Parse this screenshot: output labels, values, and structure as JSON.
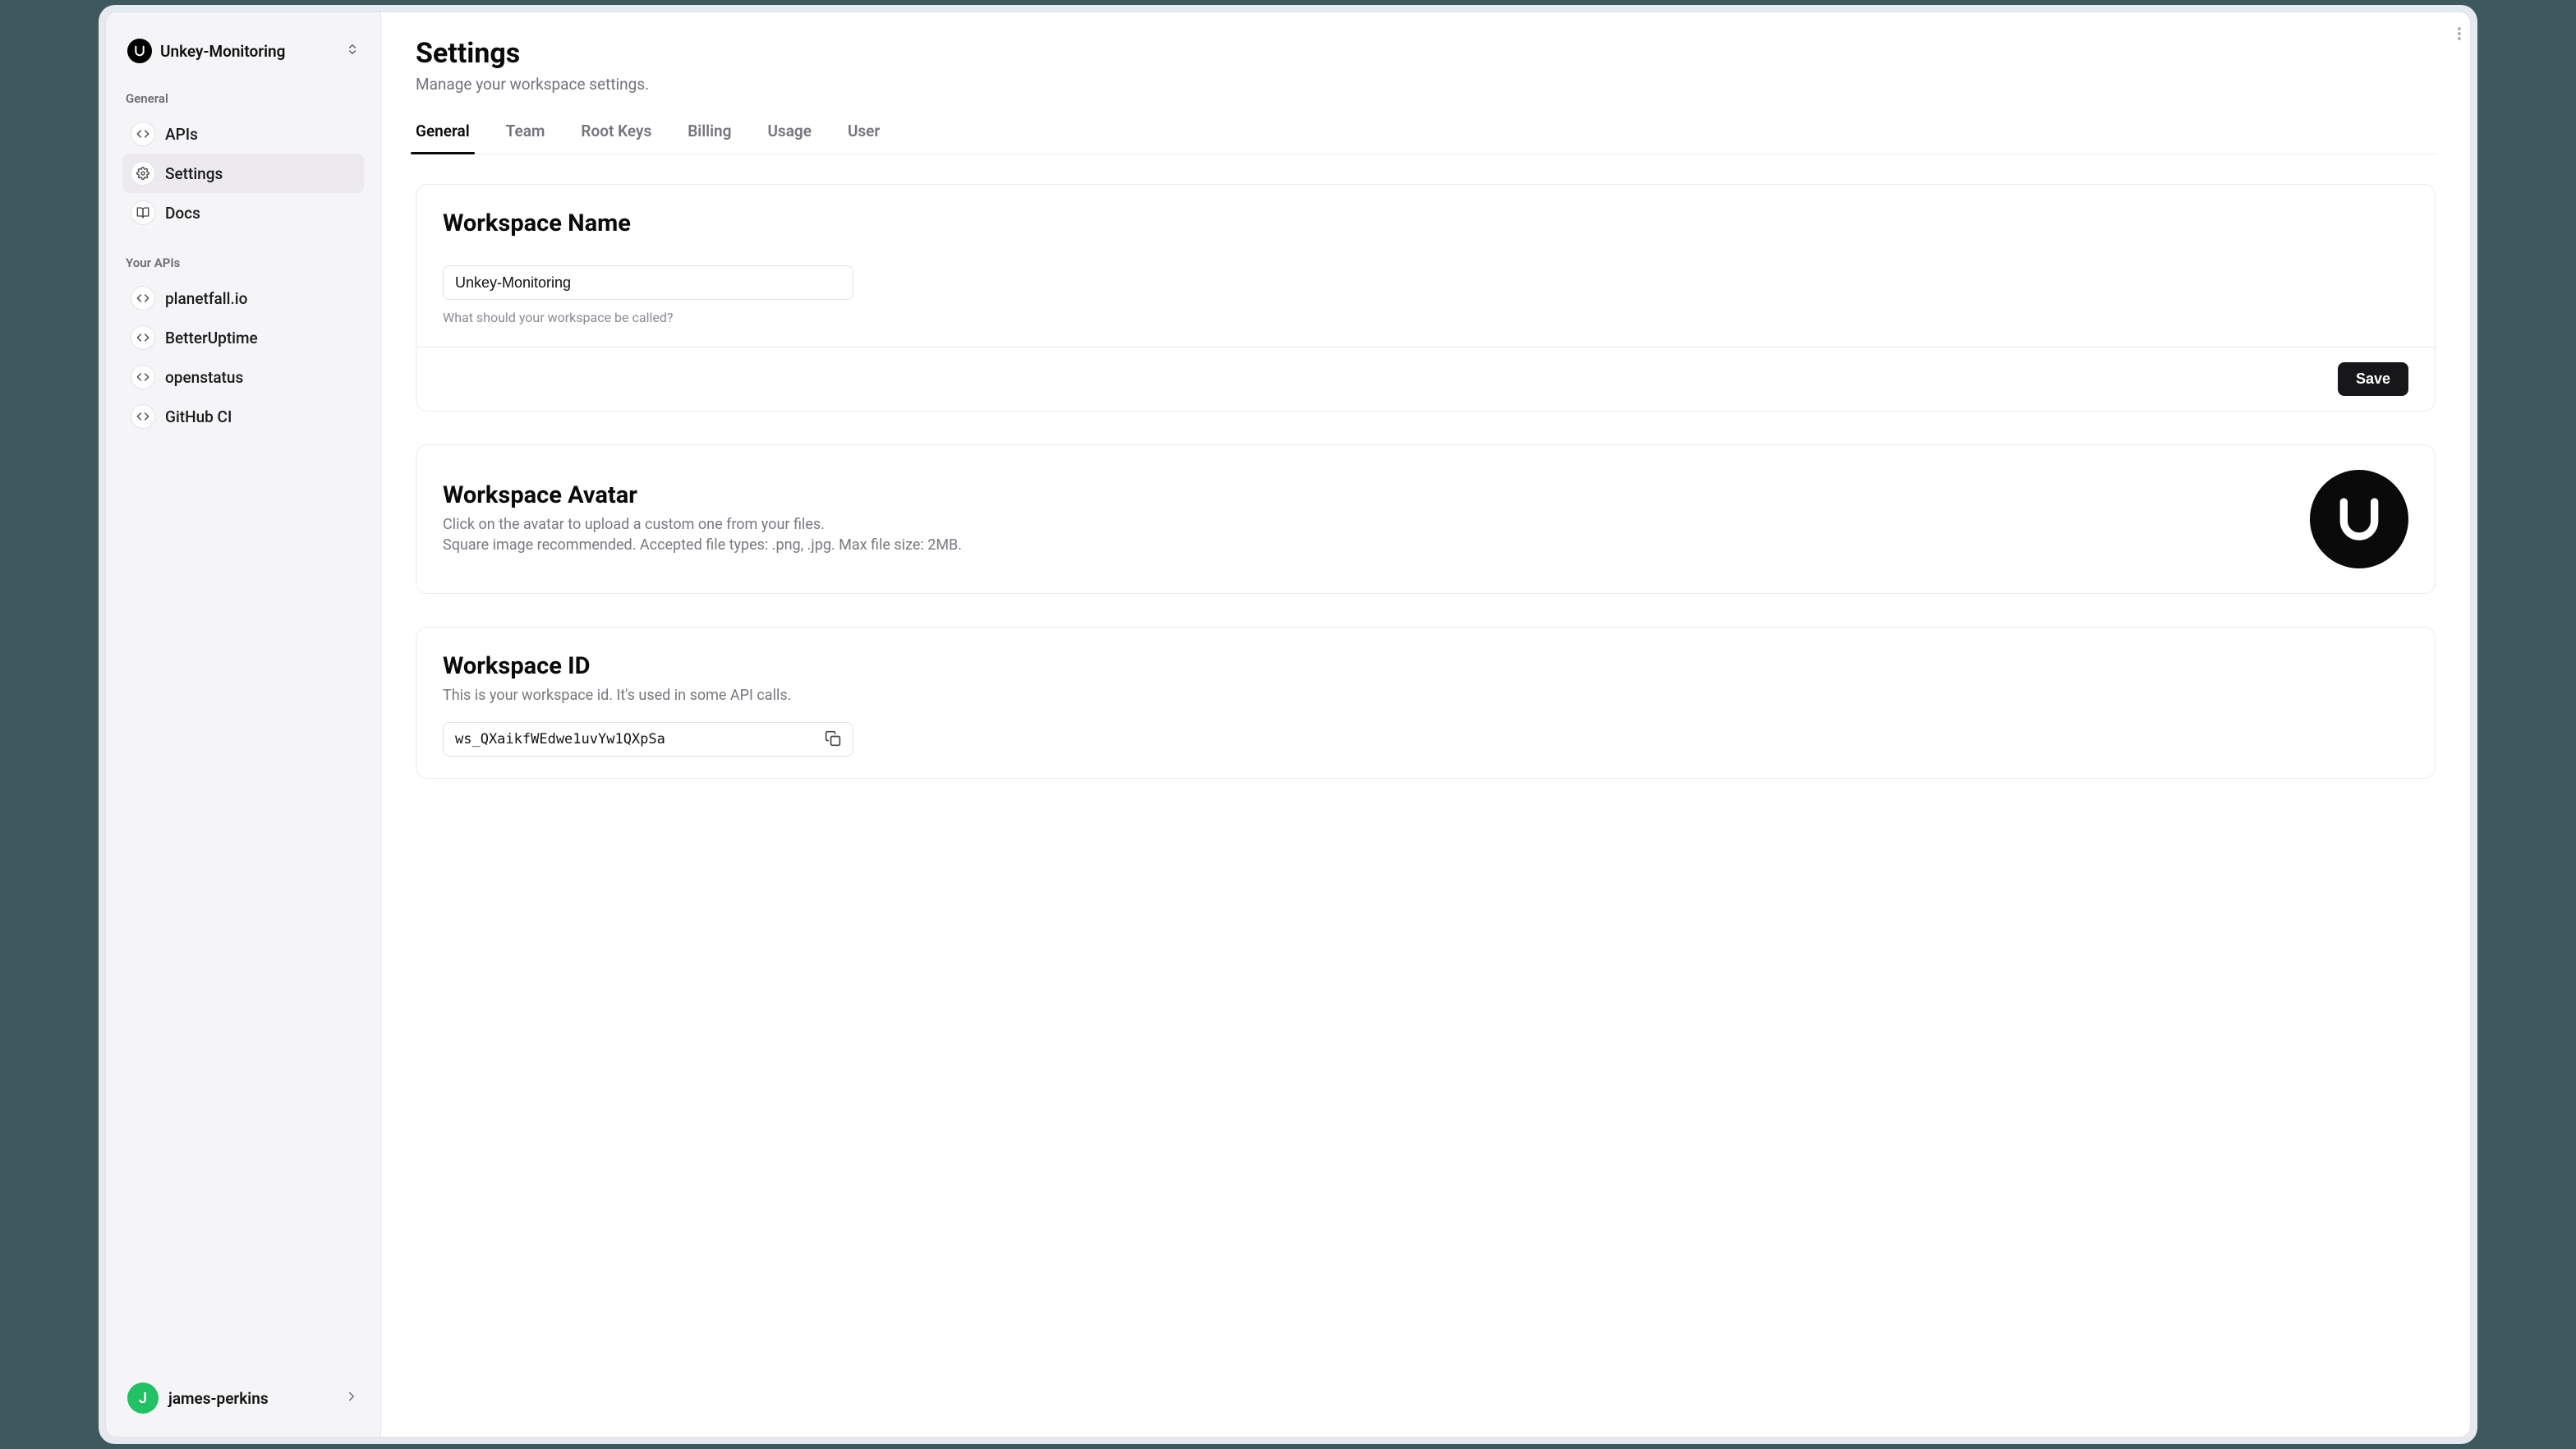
{
  "workspace": {
    "name": "Unkey-Monitoring",
    "id": "ws_QXaikfWEdwe1uvYw1QXpSa"
  },
  "sidebar": {
    "section_general_label": "General",
    "section_apis_label": "Your APIs",
    "items_general": [
      {
        "label": "APIs"
      },
      {
        "label": "Settings"
      },
      {
        "label": "Docs"
      }
    ],
    "items_apis": [
      {
        "label": "planetfall.io"
      },
      {
        "label": "BetterUptime"
      },
      {
        "label": "openstatus"
      },
      {
        "label": "GitHub CI"
      }
    ]
  },
  "user": {
    "handle": "james-perkins",
    "initial": "J"
  },
  "page": {
    "title": "Settings",
    "subtitle": "Manage your workspace settings."
  },
  "tabs": [
    {
      "label": "General"
    },
    {
      "label": "Team"
    },
    {
      "label": "Root Keys"
    },
    {
      "label": "Billing"
    },
    {
      "label": "Usage"
    },
    {
      "label": "User"
    }
  ],
  "cards": {
    "name": {
      "title": "Workspace Name",
      "hint": "What should your workspace be called?",
      "save_label": "Save"
    },
    "avatar": {
      "title": "Workspace Avatar",
      "desc1": "Click on the avatar to upload a custom one from your files.",
      "desc2": "Square image recommended. Accepted file types: .png, .jpg. Max file size: 2MB."
    },
    "id": {
      "title": "Workspace ID",
      "desc": "This is your workspace id. It's used in some API calls."
    }
  }
}
